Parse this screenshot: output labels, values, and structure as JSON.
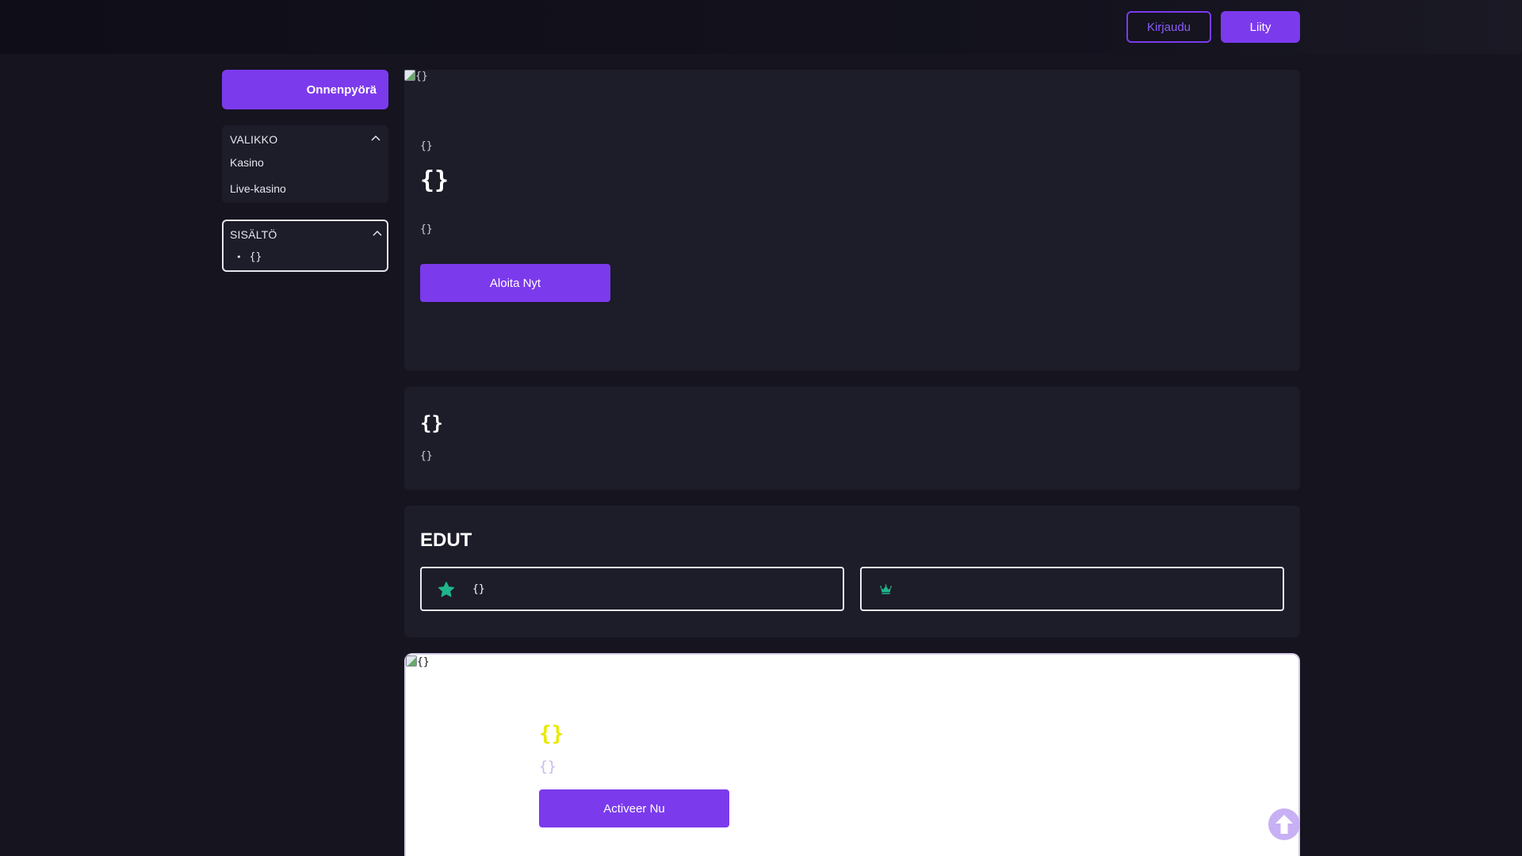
{
  "header": {
    "login_label": "Kirjaudu",
    "join_label": "Liity"
  },
  "sidebar": {
    "promo_label": "Onnenpyörä",
    "menu": {
      "title": "VALIKKO",
      "items": [
        {
          "label": "Kasino"
        },
        {
          "label": "Live-kasino"
        }
      ]
    },
    "contents": {
      "title": "SISÄLTÖ",
      "items": [
        {
          "label": "{}"
        }
      ]
    }
  },
  "hero": {
    "image_alt": "{}",
    "subtitle": "{}",
    "title": "{}",
    "description": "{}",
    "cta_label": "Aloita Nyt"
  },
  "intro": {
    "title": "{}",
    "text": "{}"
  },
  "benefits": {
    "title": "EDUT",
    "cards": [
      {
        "icon": "star-icon",
        "text": "{}"
      },
      {
        "icon": "crown-icon",
        "text": ""
      }
    ]
  },
  "promo": {
    "image_alt": "{}",
    "title": "{}",
    "subtitle": "{}",
    "cta_label": "Activeer Nu"
  },
  "colors": {
    "accent": "#7c3aed",
    "background": "#15141f",
    "panel": "#1d1c29",
    "benefit_icon": "#1fb58a",
    "promo_title": "#e8e800"
  }
}
